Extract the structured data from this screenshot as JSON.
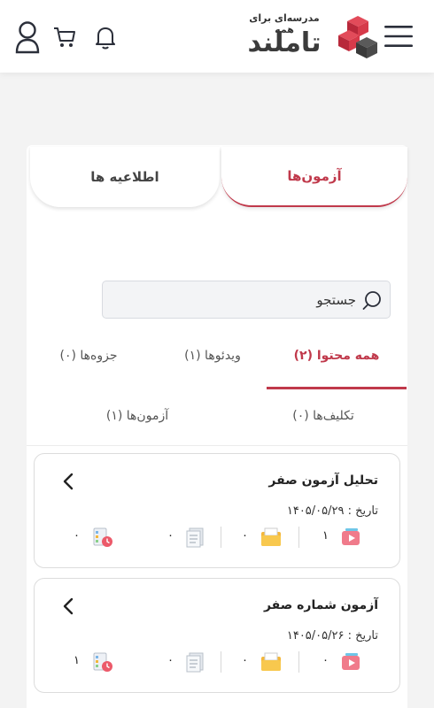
{
  "header": {
    "logo_tagline": "مدرسه‌ای برای همه",
    "logo_name": "تاملند",
    "icons": [
      "user-icon",
      "cart-icon",
      "bell-icon",
      "menu-icon"
    ],
    "brand_color": "#d63a4a"
  },
  "top_tabs": [
    {
      "label": "آزمون‌ها",
      "active": true
    },
    {
      "label": "اطلاعیه ها",
      "active": false
    }
  ],
  "search": {
    "placeholder": "جستجو",
    "value": ""
  },
  "filter_tabs": {
    "all": "همه محتوا (۲)",
    "videos": "ویدئوها (۱)",
    "pamphlets": "جزوه‌ها (۰)",
    "assignments": "تکلیف‌ها (۰)",
    "exams": "آزمون‌ها (۱)"
  },
  "accent_color": "#c0394b",
  "items": [
    {
      "title": "تحلیل آزمون صفر",
      "date": "تاریخ : ۱۴۰۵/۰۵/۲۹",
      "stats": {
        "videos": "۱",
        "folders": "۰",
        "docs": "۰",
        "quizzes": "۰"
      }
    },
    {
      "title": "آزمون شماره صفر",
      "date": "تاریخ : ۱۴۰۵/۰۵/۲۶",
      "stats": {
        "videos": "۰",
        "folders": "۰",
        "docs": "۰",
        "quizzes": "۱"
      }
    }
  ]
}
